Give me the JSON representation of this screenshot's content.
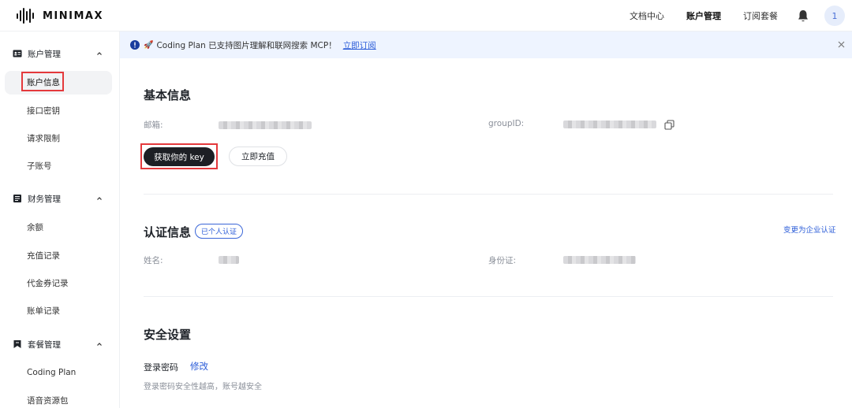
{
  "app": {
    "logo_text": "MINIMAX"
  },
  "topnav": {
    "docs": "文档中心",
    "account": "账户管理",
    "subscription": "订阅套餐",
    "avatar": "1"
  },
  "sidebar": {
    "groups": [
      {
        "label": "账户管理",
        "items": [
          "账户信息",
          "接口密钥",
          "请求限制",
          "子账号"
        ]
      },
      {
        "label": "财务管理",
        "items": [
          "余额",
          "充值记录",
          "代金券记录",
          "账单记录"
        ]
      },
      {
        "label": "套餐管理",
        "items": [
          "Coding Plan",
          "语音资源包"
        ]
      }
    ],
    "active_item": "账户信息"
  },
  "banner": {
    "text": "Coding Plan 已支持图片理解和联网搜索 MCP！",
    "link": "立即订阅"
  },
  "basic": {
    "title": "基本信息",
    "email_label": "邮箱:",
    "group_label": "groupID:",
    "get_key": "获取你的 key",
    "recharge": "立即充值"
  },
  "auth": {
    "title": "认证信息",
    "badge": "已个人认证",
    "change": "变更为企业认证",
    "name_label": "姓名:",
    "id_label": "身份证:"
  },
  "security": {
    "title": "安全设置",
    "password_label": "登录密码",
    "edit": "修改",
    "hint": "登录密码安全性越高，账号越安全"
  },
  "colors": {
    "accent": "#2b5cd8",
    "highlight": "#e4393c",
    "banner_bg": "#eef4ff",
    "button_dark": "#1d1f24"
  }
}
